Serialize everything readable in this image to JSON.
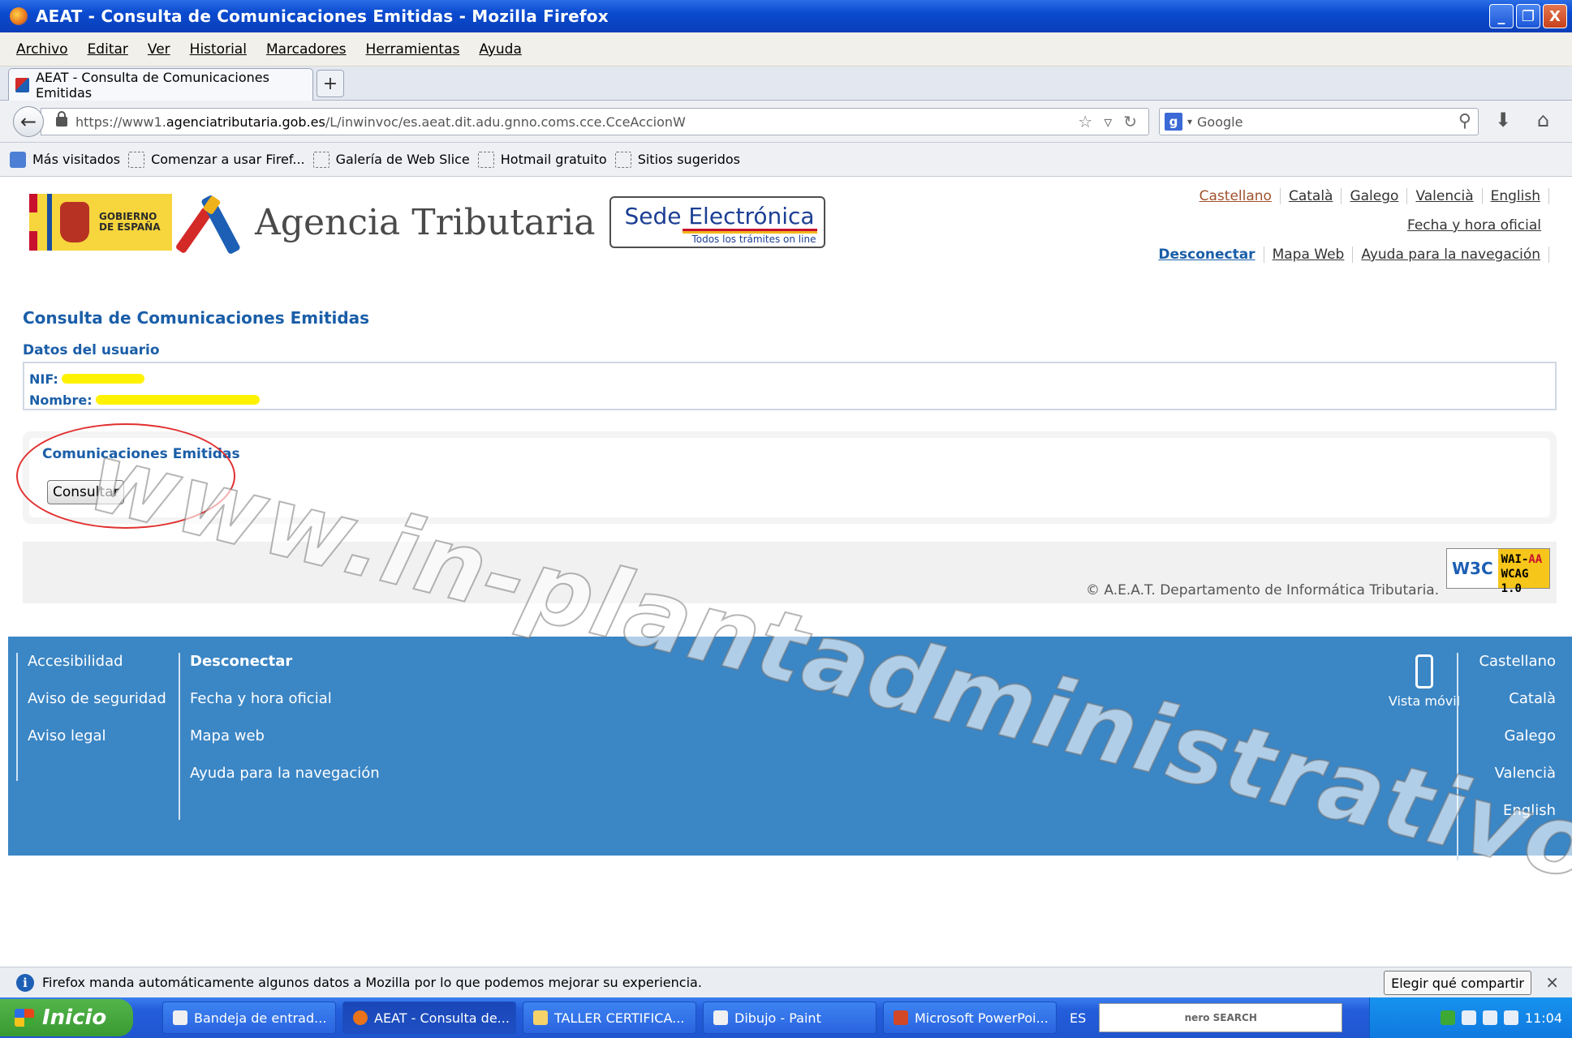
{
  "window": {
    "title": "AEAT - Consulta de Comunicaciones Emitidas - Mozilla Firefox",
    "min": "_",
    "max": "❐",
    "close": "X"
  },
  "menu": [
    "Archivo",
    "Editar",
    "Ver",
    "Historial",
    "Marcadores",
    "Herramientas",
    "Ayuda"
  ],
  "tab": {
    "label": "AEAT - Consulta de Comunicaciones Emitidas",
    "new": "+"
  },
  "nav": {
    "url_prefix": "https://www1.",
    "url_domain": "agenciatributaria.gob.es",
    "url_path": "/L/inwinvoc/es.aeat.dit.adu.gnno.coms.cce.CceAccionW",
    "search_placeholder": "Google"
  },
  "bookmarks": [
    "Más visitados",
    "Comenzar a usar Firef...",
    "Galería de Web Slice",
    "Hotmail gratuito",
    "Sitios sugeridos"
  ],
  "header": {
    "gob_line1": "GOBIERNO",
    "gob_line2": "DE ESPAÑA",
    "agency": "Agencia Tributaria",
    "sede": "Sede Electrónica",
    "sede_sub": "Todos los trámites on line",
    "langs": [
      "Castellano",
      "Català",
      "Galego",
      "Valencià",
      "English"
    ],
    "fecha": "Fecha y hora oficial",
    "links": [
      "Desconectar",
      "Mapa Web",
      "Ayuda para la navegación"
    ]
  },
  "main": {
    "title": "Consulta de Comunicaciones Emitidas",
    "user_section": "Datos del usuario",
    "nif_label": "NIF:",
    "nombre_label": "Nombre:",
    "comm_title": "Comunicaciones Emitidas",
    "consult_button": "Consultar",
    "copyright": "© A.E.A.T. Departamento de Informática Tributaria.",
    "w3c": "W3C",
    "wai_line1": "WAI-",
    "wai_line1b": "AA",
    "wai_line2": "WCAG 1.0"
  },
  "footer": {
    "col1": [
      "Accesibilidad",
      "Aviso de seguridad",
      "Aviso legal"
    ],
    "col2": [
      "Desconectar",
      "Fecha y hora oficial",
      "Mapa web",
      "Ayuda para la navegación"
    ],
    "mobile": "Vista móvil",
    "langs": [
      "Castellano",
      "Català",
      "Galego",
      "Valencià",
      "English"
    ]
  },
  "watermark": "www.in-plantadministrativos.com",
  "notification": {
    "text": "Firefox manda automáticamente algunos datos a Mozilla por lo que podemos mejorar su experiencia.",
    "button": "Elegir qué compartir",
    "close": "×"
  },
  "taskbar": {
    "start": "Inicio",
    "tasks": [
      "Bandeja de entrad...",
      "AEAT - Consulta de...",
      "TALLER CERTIFICA...",
      "Dibujo - Paint",
      "Microsoft PowerPoi..."
    ],
    "lang": "ES",
    "nero": "nero SEARCH",
    "time": "11:04"
  }
}
